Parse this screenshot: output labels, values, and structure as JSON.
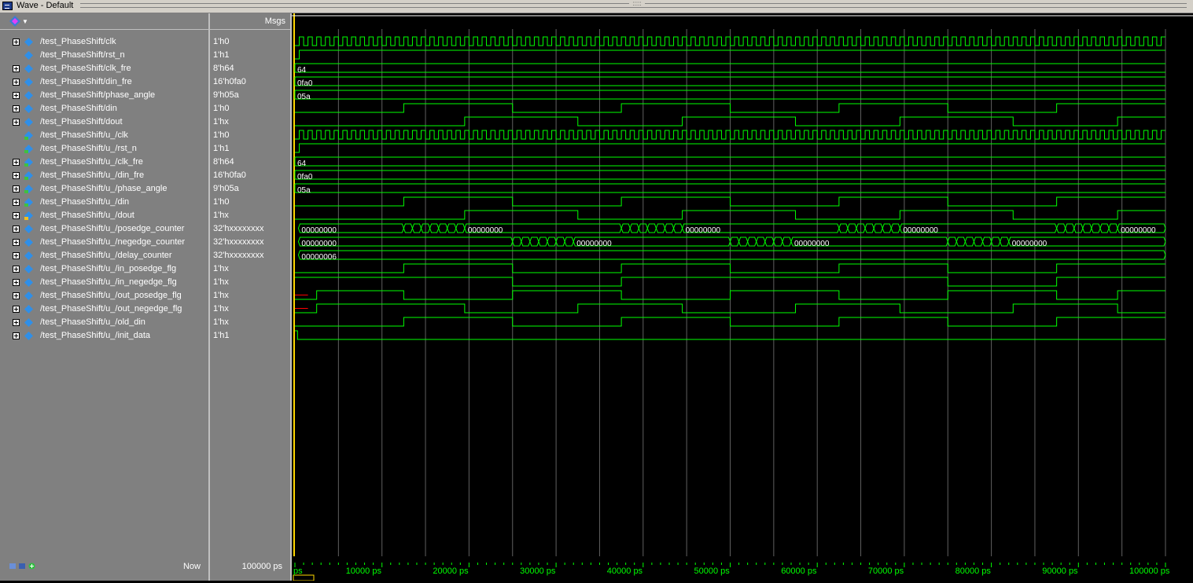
{
  "window": {
    "title": "Wave - Default"
  },
  "header": {
    "msgs_label": "Msgs"
  },
  "signals": [
    {
      "name": "/test_PhaseShift/clk",
      "value": "1'h0",
      "expand": true,
      "icon": "input"
    },
    {
      "name": "/test_PhaseShift/rst_n",
      "value": "1'h1",
      "expand": false,
      "icon": "input"
    },
    {
      "name": "/test_PhaseShift/clk_fre",
      "value": "8'h64",
      "expand": true,
      "icon": "input"
    },
    {
      "name": "/test_PhaseShift/din_fre",
      "value": "16'h0fa0",
      "expand": true,
      "icon": "input"
    },
    {
      "name": "/test_PhaseShift/phase_angle",
      "value": "9'h05a",
      "expand": true,
      "icon": "input"
    },
    {
      "name": "/test_PhaseShift/din",
      "value": "1'h0",
      "expand": true,
      "icon": "input"
    },
    {
      "name": "/test_PhaseShift/dout",
      "value": "1'hx",
      "expand": true,
      "icon": "input"
    },
    {
      "name": "/test_PhaseShift/u_/clk",
      "value": "1'h0",
      "expand": false,
      "icon": "port"
    },
    {
      "name": "/test_PhaseShift/u_/rst_n",
      "value": "1'h1",
      "expand": false,
      "icon": "port"
    },
    {
      "name": "/test_PhaseShift/u_/clk_fre",
      "value": "8'h64",
      "expand": true,
      "icon": "port"
    },
    {
      "name": "/test_PhaseShift/u_/din_fre",
      "value": "16'h0fa0",
      "expand": true,
      "icon": "port"
    },
    {
      "name": "/test_PhaseShift/u_/phase_angle",
      "value": "9'h05a",
      "expand": true,
      "icon": "port"
    },
    {
      "name": "/test_PhaseShift/u_/din",
      "value": "1'h0",
      "expand": true,
      "icon": "port"
    },
    {
      "name": "/test_PhaseShift/u_/dout",
      "value": "1'hx",
      "expand": true,
      "icon": "output"
    },
    {
      "name": "/test_PhaseShift/u_/posedge_counter",
      "value": "32'hxxxxxxxx",
      "expand": true,
      "icon": "input"
    },
    {
      "name": "/test_PhaseShift/u_/negedge_counter",
      "value": "32'hxxxxxxxx",
      "expand": true,
      "icon": "input"
    },
    {
      "name": "/test_PhaseShift/u_/delay_counter",
      "value": "32'hxxxxxxxx",
      "expand": true,
      "icon": "input"
    },
    {
      "name": "/test_PhaseShift/u_/in_posedge_flg",
      "value": "1'hx",
      "expand": true,
      "icon": "input"
    },
    {
      "name": "/test_PhaseShift/u_/in_negedge_flg",
      "value": "1'hx",
      "expand": true,
      "icon": "input"
    },
    {
      "name": "/test_PhaseShift/u_/out_posedge_flg",
      "value": "1'hx",
      "expand": true,
      "icon": "input"
    },
    {
      "name": "/test_PhaseShift/u_/out_negedge_flg",
      "value": "1'hx",
      "expand": true,
      "icon": "input"
    },
    {
      "name": "/test_PhaseShift/u_/old_din",
      "value": "1'hx",
      "expand": true,
      "icon": "input"
    },
    {
      "name": "/test_PhaseShift/u_/init_data",
      "value": "1'h1",
      "expand": true,
      "icon": "input"
    }
  ],
  "bus_labels": {
    "clk_fre": "64",
    "din_fre": "0fa0",
    "phase_angle": "05a",
    "posedge_counter": "00000000",
    "negedge_counter": "00000000",
    "delay_counter": "00000006"
  },
  "status": {
    "now_label": "Now",
    "now_value": "100000 ps",
    "cursor_label": "ps"
  },
  "time_axis": {
    "unit": "ps",
    "start": 0,
    "end": 100000,
    "ticks": [
      "10000 ps",
      "20000 ps",
      "30000 ps",
      "40000 ps",
      "50000 ps",
      "60000 ps",
      "70000 ps",
      "80000 ps",
      "90000 ps",
      "100000 ps"
    ]
  },
  "colors": {
    "wave": "#00ff00",
    "x_state": "#ff0000",
    "cursor": "#ffd700",
    "grid": "#606060"
  }
}
